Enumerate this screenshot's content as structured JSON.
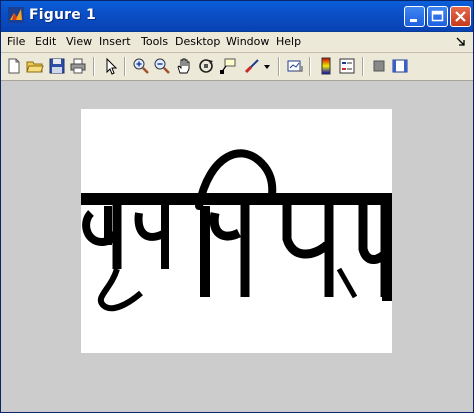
{
  "window": {
    "title": "Figure 1"
  },
  "menubar": {
    "items": [
      "File",
      "Edit",
      "View",
      "Insert",
      "Tools",
      "Desktop",
      "Window",
      "Help"
    ]
  },
  "toolbar": {
    "tools": [
      "new-figure-icon",
      "open-file-icon",
      "save-icon",
      "print-icon",
      "edit-plot-icon",
      "zoom-in-icon",
      "zoom-out-icon",
      "pan-icon",
      "rotate-3d-icon",
      "data-cursor-icon",
      "brush-icon",
      "brush-dropdown-icon",
      "link-plot-icon",
      "insert-colorbar-icon",
      "insert-legend-icon",
      "hide-plot-tools-icon",
      "show-plot-tools-icon"
    ]
  },
  "figure": {
    "image_text": "सुमित"
  },
  "colors": {
    "titlebar": "#0b4fc7",
    "figure_bg": "#cccccc",
    "axes_bg": "#ffffff"
  }
}
